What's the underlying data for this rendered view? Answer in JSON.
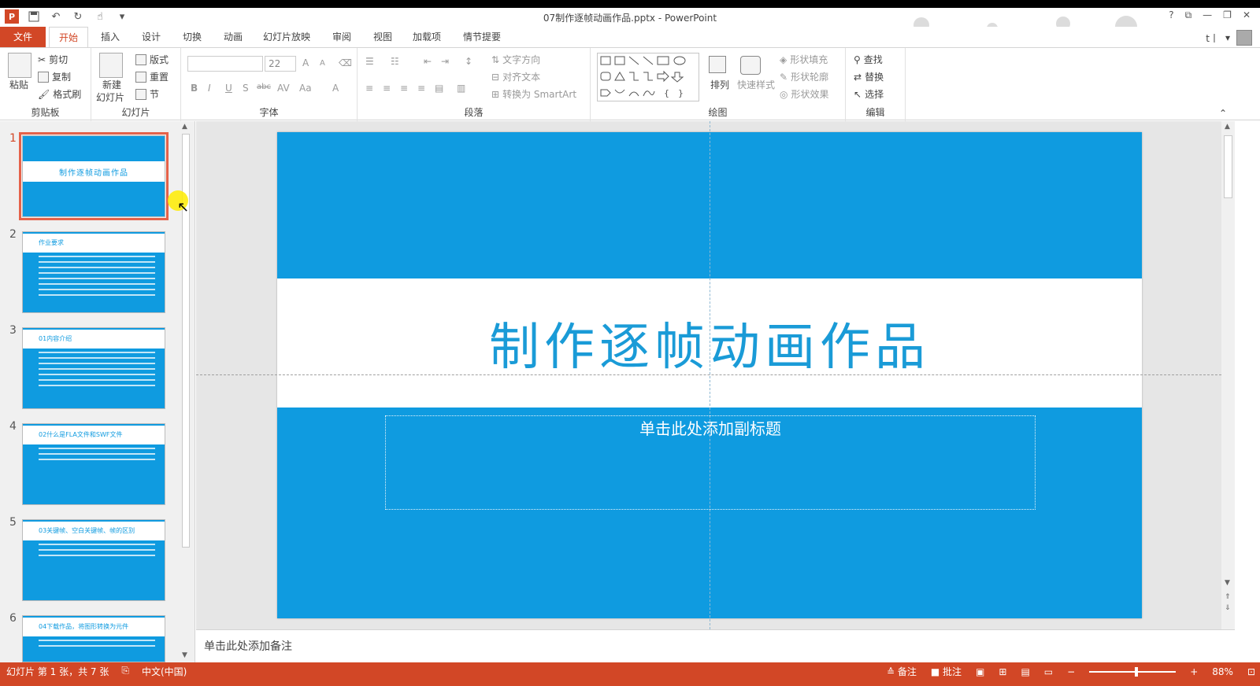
{
  "window": {
    "title": "07制作逐帧动画作品.pptx - PowerPoint",
    "controls": [
      "?",
      "⧉",
      "—",
      "❐",
      "✕"
    ]
  },
  "quick_access": {
    "icons": [
      "powerpoint-logo",
      "save-icon",
      "undo-icon",
      "redo-icon",
      "touch-mode-icon",
      "customize-icon"
    ],
    "logo_text": "P"
  },
  "tabs": {
    "file": "文件",
    "items": [
      "开始",
      "插入",
      "设计",
      "切换",
      "动画",
      "幻灯片放映",
      "审阅",
      "视图",
      "加载项",
      "情节提要"
    ],
    "active": "开始"
  },
  "user": {
    "name": "t丨",
    "dropdown": "▾"
  },
  "ribbon": {
    "clipboard": {
      "paste": "粘贴",
      "cut": "剪切",
      "copy": "复制",
      "format_painter": "格式刷",
      "label": "剪贴板"
    },
    "slides": {
      "new_slide": "新建",
      "new_slide2": "幻灯片",
      "layout": "版式",
      "reset": "重置",
      "section": "节",
      "label": "幻灯片"
    },
    "font": {
      "font_name": "",
      "font_size": "22",
      "grow": "A",
      "shrink": "A",
      "bold": "B",
      "italic": "I",
      "underline": "U",
      "shadow": "S",
      "strike": "abc",
      "spacing": "AV",
      "case": "Aa",
      "color": "A",
      "label": "字体"
    },
    "paragraph": {
      "text_direction": "文字方向",
      "align_text": "对齐文本",
      "smartart": "转换为 SmartArt",
      "label": "段落"
    },
    "drawing": {
      "arrange": "排列",
      "quick_styles": "快速样式",
      "fill": "形状填充",
      "outline": "形状轮廓",
      "effects": "形状效果",
      "label": "绘图"
    },
    "editing": {
      "find": "查找",
      "replace": "替换",
      "select": "选择",
      "label": "编辑"
    }
  },
  "thumbnails": [
    {
      "num": "1",
      "title": "制作逐帧动画作品",
      "active": true,
      "kind": "title"
    },
    {
      "num": "2",
      "title": "作业要求",
      "active": false,
      "kind": "content"
    },
    {
      "num": "3",
      "title": "01内容介绍",
      "active": false,
      "kind": "content"
    },
    {
      "num": "4",
      "title": "02什么是FLA文件和SWF文件",
      "active": false,
      "kind": "content"
    },
    {
      "num": "5",
      "title": "03关键帧、空白关键帧、帧的区别",
      "active": false,
      "kind": "content"
    },
    {
      "num": "6",
      "title": "04下载作品，将图形转换为元件",
      "active": false,
      "kind": "content"
    }
  ],
  "slide": {
    "title": "制作逐帧动画作品",
    "subtitle_placeholder": "单击此处添加副标题",
    "bg_color": "#0f9be0",
    "title_color": "#1a9bd7"
  },
  "notes": {
    "placeholder": "单击此处添加备注"
  },
  "status": {
    "slide_info": "幻灯片 第 1 张，共 7 张",
    "language": "中文(中国)",
    "notes_btn": "备注",
    "comments_btn": "批注",
    "zoom": "88%"
  },
  "colors": {
    "accent": "#d24726",
    "ribbon_bg": "#ffffff",
    "pane_bg": "#f0f0f0"
  }
}
